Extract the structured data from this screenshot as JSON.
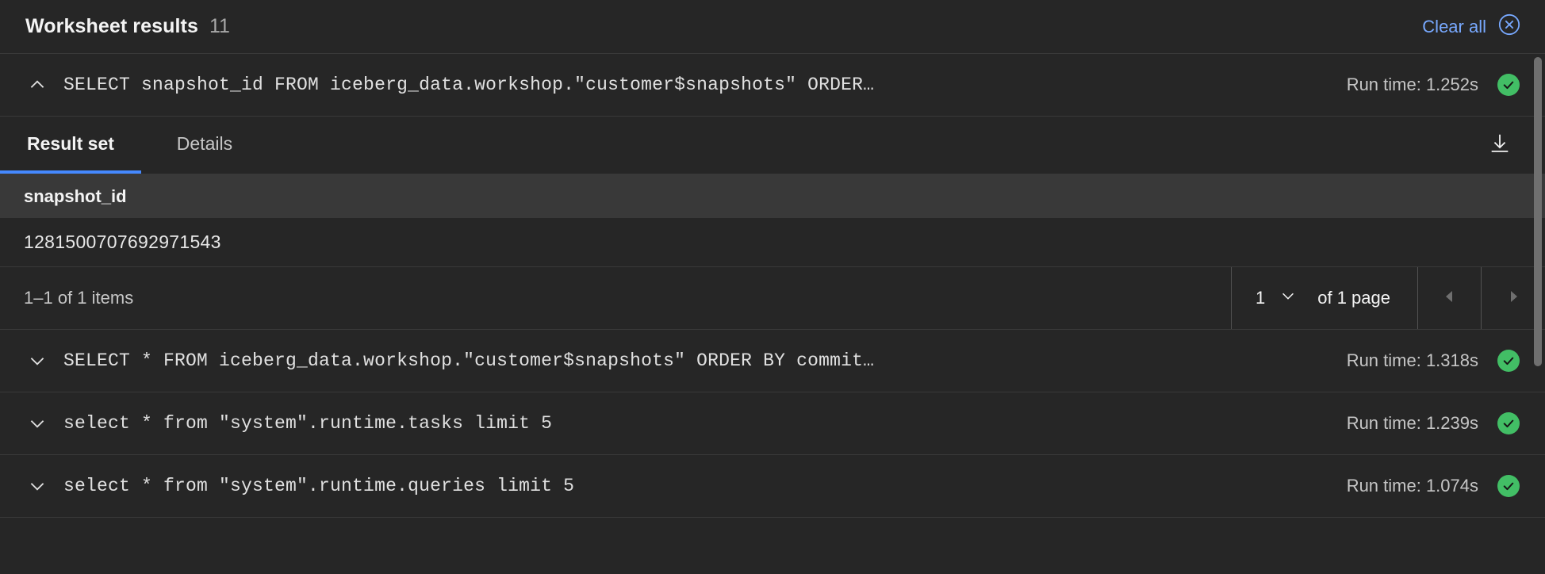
{
  "header": {
    "title": "Worksheet results",
    "count": "11",
    "clear_all_label": "Clear all",
    "clear_all_icon": "close-circle-icon",
    "accent_color": "#78a9ff"
  },
  "results": [
    {
      "expanded": true,
      "chevron_icon": "chevron-up-icon",
      "sql": "SELECT snapshot_id FROM iceberg_data.workshop.\"customer$snapshots\" ORDER…",
      "run_time": "Run time: 1.252s",
      "status_icon": "checkmark-filled-icon",
      "status_color": "#42be65"
    },
    {
      "expanded": false,
      "chevron_icon": "chevron-down-icon",
      "sql": "SELECT * FROM iceberg_data.workshop.\"customer$snapshots\" ORDER BY commit…",
      "run_time": "Run time: 1.318s",
      "status_icon": "checkmark-filled-icon",
      "status_color": "#42be65"
    },
    {
      "expanded": false,
      "chevron_icon": "chevron-down-icon",
      "sql": "select * from \"system\".runtime.tasks limit 5",
      "run_time": "Run time: 1.239s",
      "status_icon": "checkmark-filled-icon",
      "status_color": "#42be65"
    },
    {
      "expanded": false,
      "chevron_icon": "chevron-down-icon",
      "sql": "select * from \"system\".runtime.queries limit 5",
      "run_time": "Run time: 1.074s",
      "status_icon": "checkmark-filled-icon",
      "status_color": "#42be65"
    }
  ],
  "detail": {
    "tabs": [
      {
        "label": "Result set",
        "selected": true
      },
      {
        "label": "Details",
        "selected": false
      }
    ],
    "download_icon": "download-icon",
    "table": {
      "columns": [
        "snapshot_id"
      ],
      "rows": [
        [
          "1281500707692971543"
        ]
      ]
    },
    "pagination": {
      "items_label": "1–1 of 1 items",
      "page_value": "1",
      "page_select_icon": "chevron-down-icon",
      "of_pages_label": "of 1 page",
      "prev_icon": "caret-left-icon",
      "next_icon": "caret-right-icon"
    }
  }
}
